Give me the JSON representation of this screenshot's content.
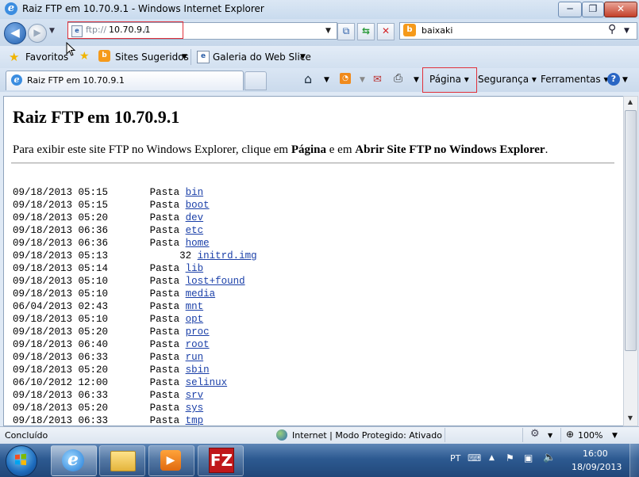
{
  "window": {
    "title": "Raiz FTP em 10.70.9.1 - Windows Internet Explorer",
    "minimize": "─",
    "maximize": "❐",
    "close": "✕"
  },
  "nav": {
    "address_scheme": "ftp://",
    "address_host": "10.70.9.1",
    "address_rest": "/",
    "search_value": "baixaki",
    "search_provider_icon": "b"
  },
  "favorites_bar": {
    "favorites_label": "Favoritos",
    "sites_label": "Sites Sugeridos",
    "galeria_label": "Galeria do Web Slice"
  },
  "tabs": [
    {
      "label": "Raiz FTP em 10.70.9.1"
    }
  ],
  "command_bar": {
    "pagina": "Página",
    "seguranca": "Segurança",
    "ferramentas": "Ferramentas"
  },
  "page": {
    "title": "Raiz FTP em 10.70.9.1",
    "intro_prefix": "Para exibir este site FTP no Windows Explorer, clique em ",
    "intro_bold1": "Página",
    "intro_mid": " e em ",
    "intro_bold2": "Abrir Site FTP no Windows Explorer",
    "intro_suffix": ".",
    "listing": [
      {
        "date": "09/18/2013",
        "time": "05:15",
        "kind": "Pasta",
        "name": "bin"
      },
      {
        "date": "09/18/2013",
        "time": "05:15",
        "kind": "Pasta",
        "name": "boot"
      },
      {
        "date": "09/18/2013",
        "time": "05:20",
        "kind": "Pasta",
        "name": "dev"
      },
      {
        "date": "09/18/2013",
        "time": "06:36",
        "kind": "Pasta",
        "name": "etc"
      },
      {
        "date": "09/18/2013",
        "time": "06:36",
        "kind": "Pasta",
        "name": "home"
      },
      {
        "date": "09/18/2013",
        "time": "05:13",
        "kind": "32",
        "name": "initrd.img"
      },
      {
        "date": "09/18/2013",
        "time": "05:14",
        "kind": "Pasta",
        "name": "lib"
      },
      {
        "date": "09/18/2013",
        "time": "05:10",
        "kind": "Pasta",
        "name": "lost+found"
      },
      {
        "date": "09/18/2013",
        "time": "05:10",
        "kind": "Pasta",
        "name": "media"
      },
      {
        "date": "06/04/2013",
        "time": "02:43",
        "kind": "Pasta",
        "name": "mnt"
      },
      {
        "date": "09/18/2013",
        "time": "05:10",
        "kind": "Pasta",
        "name": "opt"
      },
      {
        "date": "09/18/2013",
        "time": "05:20",
        "kind": "Pasta",
        "name": "proc"
      },
      {
        "date": "09/18/2013",
        "time": "06:40",
        "kind": "Pasta",
        "name": "root"
      },
      {
        "date": "09/18/2013",
        "time": "06:33",
        "kind": "Pasta",
        "name": "run"
      },
      {
        "date": "09/18/2013",
        "time": "05:20",
        "kind": "Pasta",
        "name": "sbin"
      },
      {
        "date": "06/10/2012",
        "time": "12:00",
        "kind": "Pasta",
        "name": "selinux"
      },
      {
        "date": "09/18/2013",
        "time": "06:33",
        "kind": "Pasta",
        "name": "srv"
      },
      {
        "date": "09/18/2013",
        "time": "05:20",
        "kind": "Pasta",
        "name": "sys"
      },
      {
        "date": "09/18/2013",
        "time": "06:33",
        "kind": "Pasta",
        "name": "tmp"
      }
    ]
  },
  "status": {
    "text": "Concluído",
    "zone": "Internet | Modo Protegido: Ativado",
    "zoom": "100%"
  },
  "taskbar": {
    "lang": "PT",
    "time": "16:00",
    "date": "18/09/2013",
    "filezilla_letter": "FZ"
  },
  "icons": {
    "ie": "ie-icon",
    "back": "back-arrow-icon",
    "forward": "forward-arrow-icon",
    "search": "search-icon",
    "home": "home-icon",
    "rss": "rss-feed-icon",
    "mail": "mail-icon",
    "print": "print-icon",
    "help": "help-icon"
  },
  "colors": {
    "link": "#1a3fa8",
    "highlight_box": "#e0303a",
    "search_provider": "#f59a1b"
  }
}
